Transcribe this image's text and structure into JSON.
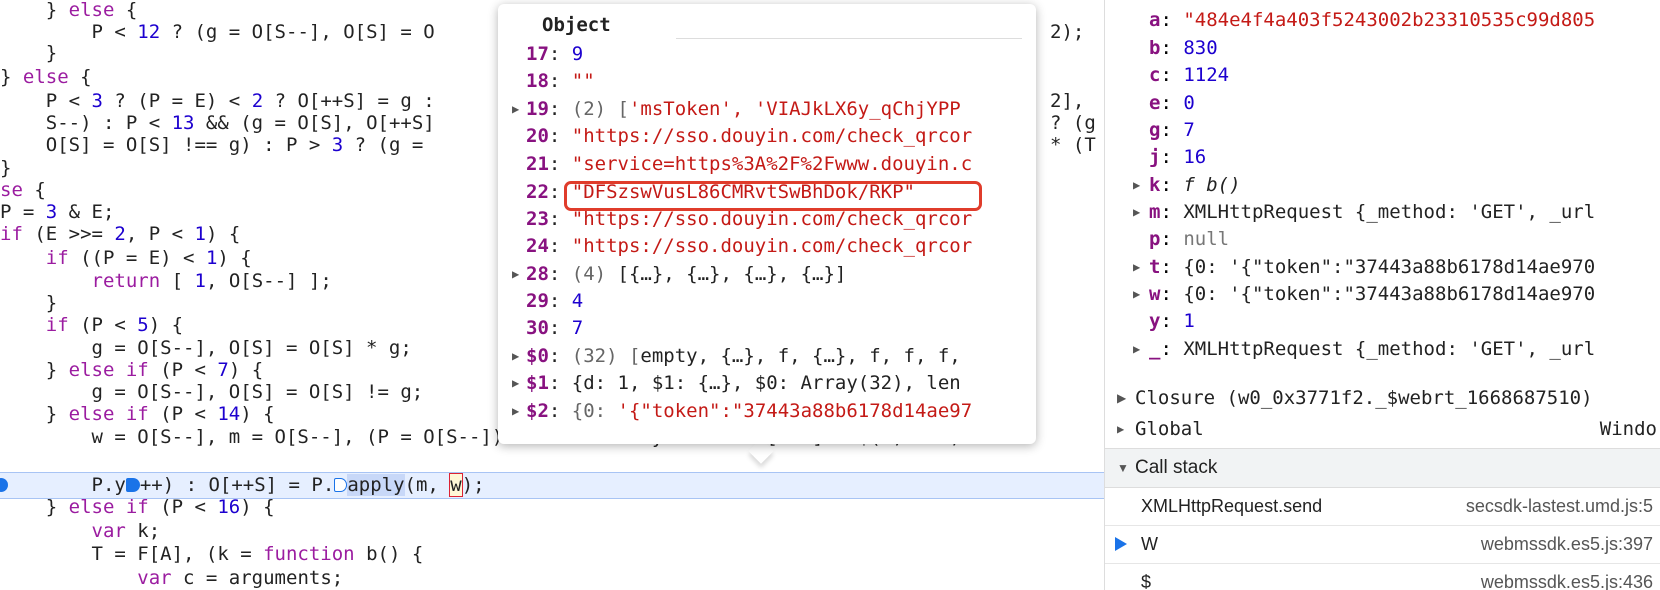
{
  "editor": {
    "lines": [
      "    } else {",
      "        P < 12 ? (g = O[S--], O[S] = O",
      "    }",
      "} else {",
      "    P < 3 ? (P = E) < 2 ? O[++S] = g :",
      "    S--) : P < 13 && (g = O[S], O[++S]",
      "    O[S] = O[S] !== g) : P > 3 ? (g =",
      "}",
      "se {",
      "P = 3 & E;",
      "if (E >>= 2, P < 1) {",
      "    if ((P = E) < 1) {",
      "        return [ 1, O[S--] ];",
      "    }",
      "    if (P < 5) {",
      "        g = O[S--], O[S] = O[S] * g;",
      "    } else if (P < 7) {",
      "        g = O[S--], O[S] = O[S] != g;",
      "    } else if (P < 14) {",
      "        w = O[S--], m = O[S--], (P = O[S--]).x === w ? P.y >= 1 ? O[++S] = $(a, P.c,",
      "        P.y  ++) : O[++S] = P.  apply(m, w);",
      "    } else if (P < 16) {",
      "        var k;",
      "        T = F[A], (k = function b() {",
      "            var c = arguments;"
    ],
    "right_fragments": {
      "line1": "2);",
      "line4": "2],",
      "line5": "? (g",
      "line6": "* (T"
    }
  },
  "popover": {
    "title": "Object",
    "rows": [
      {
        "key": "17",
        "value": "9",
        "type": "num",
        "expandable": false
      },
      {
        "key": "18",
        "value": "\"\"",
        "type": "str",
        "expandable": false
      },
      {
        "key": "19",
        "prefix": "(2) [",
        "value": "'msToken', 'VIAJkLX6y_qChjYPP",
        "type": "arr",
        "expandable": true
      },
      {
        "key": "20",
        "value": "\"https://sso.douyin.com/check_qrcor",
        "type": "str",
        "expandable": false
      },
      {
        "key": "21",
        "value": "\"service=https%3A%2F%2Fwww.douyin.c",
        "type": "str",
        "expandable": false
      },
      {
        "key": "22",
        "value": "\"DFSzswVusL86CMRvtSwBhDok/RKP\"",
        "type": "str",
        "expandable": false
      },
      {
        "key": "23",
        "value": "\"https://sso.douyin.com/check_qrcor",
        "type": "str",
        "expandable": false
      },
      {
        "key": "24",
        "value": "\"https://sso.douyin.com/check_qrcor",
        "type": "str",
        "expandable": false
      },
      {
        "key": "28",
        "prefix": "(4) ",
        "value": "[{…}, {…}, {…}, {…}]",
        "type": "obj",
        "expandable": true
      },
      {
        "key": "29",
        "value": "4",
        "type": "num",
        "expandable": false
      },
      {
        "key": "30",
        "value": "7",
        "type": "num",
        "expandable": false
      },
      {
        "key": "$0",
        "prefix": "(32) [",
        "value": "empty, {…}, f, {…}, f, f, f,",
        "type": "obj",
        "expandable": true
      },
      {
        "key": "$1",
        "prefix": "",
        "value": "{d: 1, $1: {…}, $0: Array(32), len",
        "type": "obj",
        "expandable": true
      },
      {
        "key": "$2",
        "prefix": "{0: ",
        "value": "'{\"token\":\"37443a88b6178d14ae97",
        "type": "str",
        "expandable": true
      }
    ]
  },
  "scope": {
    "rows": [
      {
        "key": "a",
        "value": "\"484e4f4a403f5243002b23310535c99d805",
        "type": "str",
        "expandable": false
      },
      {
        "key": "b",
        "value": "830",
        "type": "num",
        "expandable": false
      },
      {
        "key": "c",
        "value": "1124",
        "type": "num",
        "expandable": false
      },
      {
        "key": "e",
        "value": "0",
        "type": "num",
        "expandable": false
      },
      {
        "key": "g",
        "value": "7",
        "type": "num",
        "expandable": false
      },
      {
        "key": "j",
        "value": "16",
        "type": "num",
        "expandable": false
      },
      {
        "key": "k",
        "value": "f b()",
        "type": "fn",
        "expandable": true
      },
      {
        "key": "m",
        "value": "XMLHttpRequest {_method: 'GET', _url",
        "type": "obj",
        "expandable": true
      },
      {
        "key": "p",
        "value": "null",
        "type": "null",
        "expandable": false
      },
      {
        "key": "t",
        "value": "{0: '{\"token\":\"37443a88b6178d14ae970",
        "type": "obj",
        "expandable": true
      },
      {
        "key": "w",
        "value": "{0: '{\"token\":\"37443a88b6178d14ae970",
        "type": "obj",
        "expandable": true
      },
      {
        "key": "y",
        "value": "1",
        "type": "num",
        "expandable": false
      },
      {
        "key": "_",
        "value": "XMLHttpRequest {_method: 'GET', _url",
        "type": "obj",
        "expandable": true
      }
    ],
    "closure_label": "Closure (w0_0x3771f2._$webrt_1668687510)",
    "global_label": "Global",
    "global_value": "Windo"
  },
  "call_stack": {
    "header": "Call stack",
    "frames": [
      {
        "name": "XMLHttpRequest.send",
        "location": "secsdk-lastest.umd.js:5",
        "active": false
      },
      {
        "name": "W",
        "location": "webmssdk.es5.js:397",
        "active": true
      },
      {
        "name": "$",
        "location": "webmssdk.es5.js:436",
        "active": false
      }
    ]
  },
  "colors": {
    "keyword": "#9b1ca0",
    "number": "#1c00cf",
    "string": "#c41a16",
    "highlight_box": "#e03c2b",
    "exec_line_bg": "#e6efff"
  }
}
